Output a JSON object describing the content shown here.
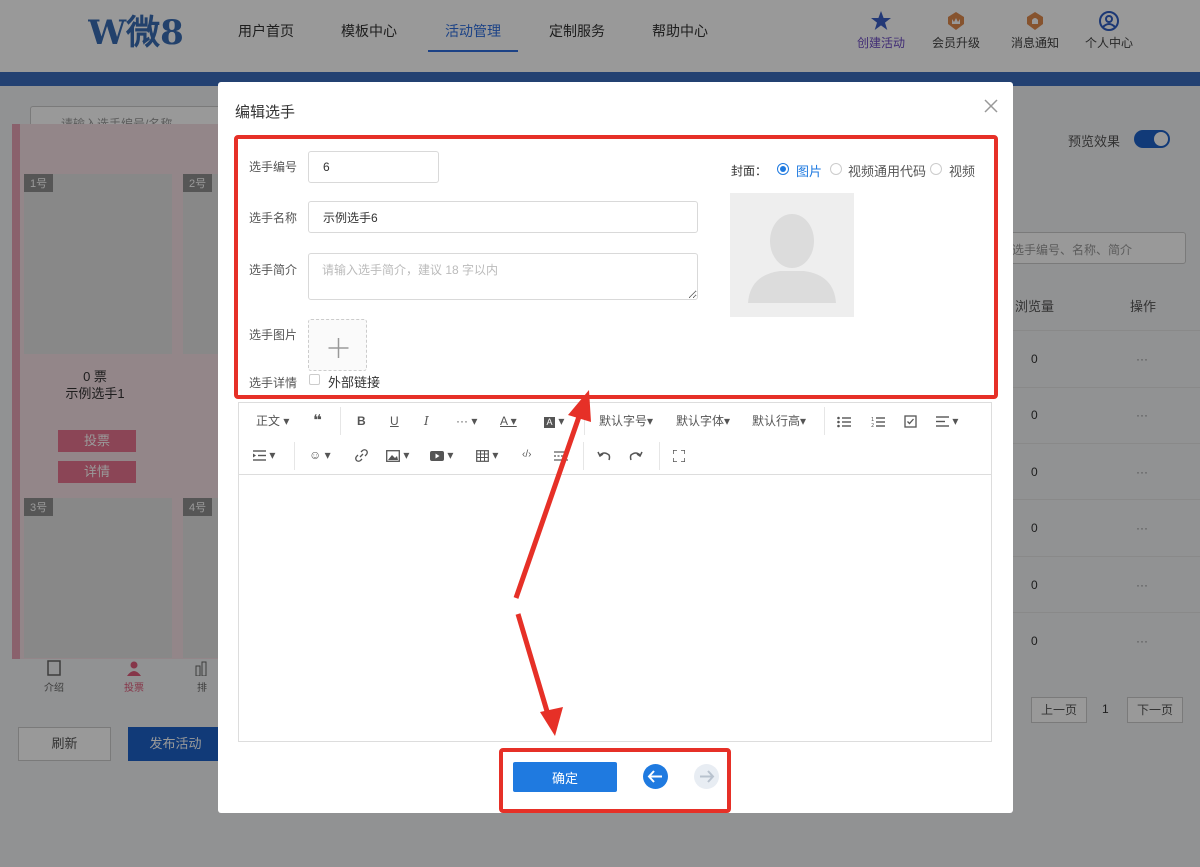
{
  "app": {
    "logo_text": "W微8",
    "nav": [
      "用户首页",
      "模板中心",
      "活动管理",
      "定制服务",
      "帮助中心"
    ],
    "right_actions": [
      "创建活动",
      "会员升级",
      "消息通知",
      "个人中心"
    ]
  },
  "background": {
    "search_placeholder": "请输入选手编号/名称",
    "cards": [
      "1号",
      "2号",
      "3号",
      "4号"
    ],
    "votes_text": "0 票",
    "player_name": "示例选手1",
    "vote_button": "投票",
    "detail_button": "详情",
    "bottom_tabs": [
      "介绍",
      "投票",
      "排"
    ],
    "refresh_button": "刷新",
    "publish_button": "发布活动",
    "preview_label": "预览效果",
    "table_search_placeholder": "选手编号、名称、简介",
    "columns": [
      "浏览量",
      "操作"
    ],
    "row_values": [
      "0",
      "0",
      "0",
      "0",
      "0",
      "0"
    ],
    "row_action": "···",
    "pagination": {
      "prev": "上一页",
      "page": "1",
      "next": "下一页"
    }
  },
  "modal": {
    "title": "编辑选手",
    "fields": {
      "number_label": "选手编号",
      "number_value": "6",
      "name_label": "选手名称",
      "name_value": "示例选手6",
      "intro_label": "选手简介",
      "intro_placeholder": "请输入选手简介，建议 18 字以内",
      "image_label": "选手图片",
      "detail_label": "选手详情",
      "external_link_label": "外部链接"
    },
    "cover": {
      "label": "封面：",
      "options": [
        "图片",
        "视频通用代码",
        "视频"
      ],
      "selected": "图片"
    },
    "toolbar": {
      "paragraph": "正文",
      "font_size": "默认字号",
      "font_family": "默认字体",
      "line_height": "默认行高",
      "more": "···"
    },
    "confirm_button": "确定"
  },
  "colors": {
    "primary": "#1f7ae0",
    "annotation_red": "#e63027",
    "nav_active": "#2f6fe0",
    "accent_pink": "#e8738f"
  }
}
